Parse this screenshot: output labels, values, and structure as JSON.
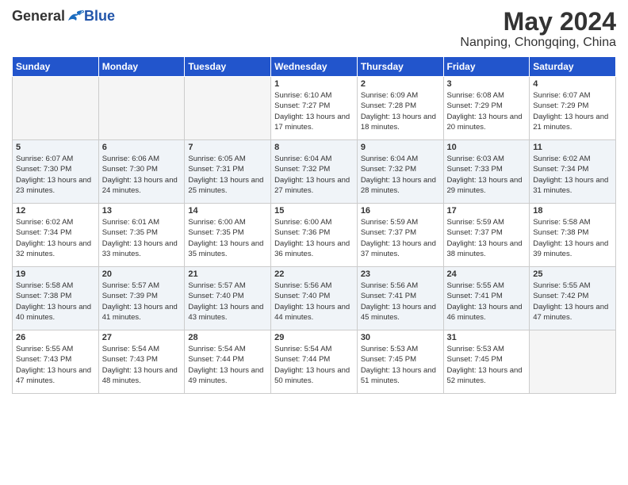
{
  "logo": {
    "general": "General",
    "blue": "Blue"
  },
  "title": "May 2024",
  "location": "Nanping, Chongqing, China",
  "weekdays": [
    "Sunday",
    "Monday",
    "Tuesday",
    "Wednesday",
    "Thursday",
    "Friday",
    "Saturday"
  ],
  "weeks": [
    [
      {
        "day": "",
        "sunrise": "",
        "sunset": "",
        "daylight": ""
      },
      {
        "day": "",
        "sunrise": "",
        "sunset": "",
        "daylight": ""
      },
      {
        "day": "",
        "sunrise": "",
        "sunset": "",
        "daylight": ""
      },
      {
        "day": "1",
        "sunrise": "Sunrise: 6:10 AM",
        "sunset": "Sunset: 7:27 PM",
        "daylight": "Daylight: 13 hours and 17 minutes."
      },
      {
        "day": "2",
        "sunrise": "Sunrise: 6:09 AM",
        "sunset": "Sunset: 7:28 PM",
        "daylight": "Daylight: 13 hours and 18 minutes."
      },
      {
        "day": "3",
        "sunrise": "Sunrise: 6:08 AM",
        "sunset": "Sunset: 7:29 PM",
        "daylight": "Daylight: 13 hours and 20 minutes."
      },
      {
        "day": "4",
        "sunrise": "Sunrise: 6:07 AM",
        "sunset": "Sunset: 7:29 PM",
        "daylight": "Daylight: 13 hours and 21 minutes."
      }
    ],
    [
      {
        "day": "5",
        "sunrise": "Sunrise: 6:07 AM",
        "sunset": "Sunset: 7:30 PM",
        "daylight": "Daylight: 13 hours and 23 minutes."
      },
      {
        "day": "6",
        "sunrise": "Sunrise: 6:06 AM",
        "sunset": "Sunset: 7:30 PM",
        "daylight": "Daylight: 13 hours and 24 minutes."
      },
      {
        "day": "7",
        "sunrise": "Sunrise: 6:05 AM",
        "sunset": "Sunset: 7:31 PM",
        "daylight": "Daylight: 13 hours and 25 minutes."
      },
      {
        "day": "8",
        "sunrise": "Sunrise: 6:04 AM",
        "sunset": "Sunset: 7:32 PM",
        "daylight": "Daylight: 13 hours and 27 minutes."
      },
      {
        "day": "9",
        "sunrise": "Sunrise: 6:04 AM",
        "sunset": "Sunset: 7:32 PM",
        "daylight": "Daylight: 13 hours and 28 minutes."
      },
      {
        "day": "10",
        "sunrise": "Sunrise: 6:03 AM",
        "sunset": "Sunset: 7:33 PM",
        "daylight": "Daylight: 13 hours and 29 minutes."
      },
      {
        "day": "11",
        "sunrise": "Sunrise: 6:02 AM",
        "sunset": "Sunset: 7:34 PM",
        "daylight": "Daylight: 13 hours and 31 minutes."
      }
    ],
    [
      {
        "day": "12",
        "sunrise": "Sunrise: 6:02 AM",
        "sunset": "Sunset: 7:34 PM",
        "daylight": "Daylight: 13 hours and 32 minutes."
      },
      {
        "day": "13",
        "sunrise": "Sunrise: 6:01 AM",
        "sunset": "Sunset: 7:35 PM",
        "daylight": "Daylight: 13 hours and 33 minutes."
      },
      {
        "day": "14",
        "sunrise": "Sunrise: 6:00 AM",
        "sunset": "Sunset: 7:35 PM",
        "daylight": "Daylight: 13 hours and 35 minutes."
      },
      {
        "day": "15",
        "sunrise": "Sunrise: 6:00 AM",
        "sunset": "Sunset: 7:36 PM",
        "daylight": "Daylight: 13 hours and 36 minutes."
      },
      {
        "day": "16",
        "sunrise": "Sunrise: 5:59 AM",
        "sunset": "Sunset: 7:37 PM",
        "daylight": "Daylight: 13 hours and 37 minutes."
      },
      {
        "day": "17",
        "sunrise": "Sunrise: 5:59 AM",
        "sunset": "Sunset: 7:37 PM",
        "daylight": "Daylight: 13 hours and 38 minutes."
      },
      {
        "day": "18",
        "sunrise": "Sunrise: 5:58 AM",
        "sunset": "Sunset: 7:38 PM",
        "daylight": "Daylight: 13 hours and 39 minutes."
      }
    ],
    [
      {
        "day": "19",
        "sunrise": "Sunrise: 5:58 AM",
        "sunset": "Sunset: 7:38 PM",
        "daylight": "Daylight: 13 hours and 40 minutes."
      },
      {
        "day": "20",
        "sunrise": "Sunrise: 5:57 AM",
        "sunset": "Sunset: 7:39 PM",
        "daylight": "Daylight: 13 hours and 41 minutes."
      },
      {
        "day": "21",
        "sunrise": "Sunrise: 5:57 AM",
        "sunset": "Sunset: 7:40 PM",
        "daylight": "Daylight: 13 hours and 43 minutes."
      },
      {
        "day": "22",
        "sunrise": "Sunrise: 5:56 AM",
        "sunset": "Sunset: 7:40 PM",
        "daylight": "Daylight: 13 hours and 44 minutes."
      },
      {
        "day": "23",
        "sunrise": "Sunrise: 5:56 AM",
        "sunset": "Sunset: 7:41 PM",
        "daylight": "Daylight: 13 hours and 45 minutes."
      },
      {
        "day": "24",
        "sunrise": "Sunrise: 5:55 AM",
        "sunset": "Sunset: 7:41 PM",
        "daylight": "Daylight: 13 hours and 46 minutes."
      },
      {
        "day": "25",
        "sunrise": "Sunrise: 5:55 AM",
        "sunset": "Sunset: 7:42 PM",
        "daylight": "Daylight: 13 hours and 47 minutes."
      }
    ],
    [
      {
        "day": "26",
        "sunrise": "Sunrise: 5:55 AM",
        "sunset": "Sunset: 7:43 PM",
        "daylight": "Daylight: 13 hours and 47 minutes."
      },
      {
        "day": "27",
        "sunrise": "Sunrise: 5:54 AM",
        "sunset": "Sunset: 7:43 PM",
        "daylight": "Daylight: 13 hours and 48 minutes."
      },
      {
        "day": "28",
        "sunrise": "Sunrise: 5:54 AM",
        "sunset": "Sunset: 7:44 PM",
        "daylight": "Daylight: 13 hours and 49 minutes."
      },
      {
        "day": "29",
        "sunrise": "Sunrise: 5:54 AM",
        "sunset": "Sunset: 7:44 PM",
        "daylight": "Daylight: 13 hours and 50 minutes."
      },
      {
        "day": "30",
        "sunrise": "Sunrise: 5:53 AM",
        "sunset": "Sunset: 7:45 PM",
        "daylight": "Daylight: 13 hours and 51 minutes."
      },
      {
        "day": "31",
        "sunrise": "Sunrise: 5:53 AM",
        "sunset": "Sunset: 7:45 PM",
        "daylight": "Daylight: 13 hours and 52 minutes."
      },
      {
        "day": "",
        "sunrise": "",
        "sunset": "",
        "daylight": ""
      }
    ]
  ]
}
